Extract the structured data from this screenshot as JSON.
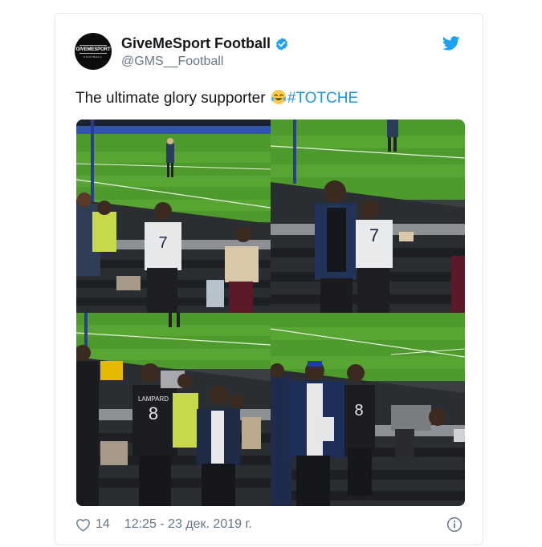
{
  "tweet": {
    "display_name": "GiveMeSport Football",
    "handle": "@GMS__Football",
    "avatar_text": "GIVEMESPORT",
    "avatar_sub": "FOOTBALL",
    "text_before": "The ultimate glory supporter",
    "emoji": "face-with-tears-of-joy",
    "hashtag": "#TOTCHE",
    "likes": "14",
    "timestamp": "12:25 - 23 дек. 2019 г.",
    "photos": [
      {
        "shirt_number": "7",
        "shirt_name": ""
      },
      {
        "shirt_number": "7",
        "shirt_name": ""
      },
      {
        "shirt_number": "8",
        "shirt_name": "LAMPARD"
      },
      {
        "shirt_number": "8",
        "shirt_name": ""
      }
    ]
  },
  "colors": {
    "verified": "#1da1f2",
    "twitter_blue": "#1da1f2",
    "hashtag": "#1b95e0",
    "pitch": "#4f9a2c",
    "secondary_text": "#657786"
  },
  "icons": [
    "verified-badge-icon",
    "twitter-bird-icon",
    "heart-icon",
    "info-icon"
  ]
}
